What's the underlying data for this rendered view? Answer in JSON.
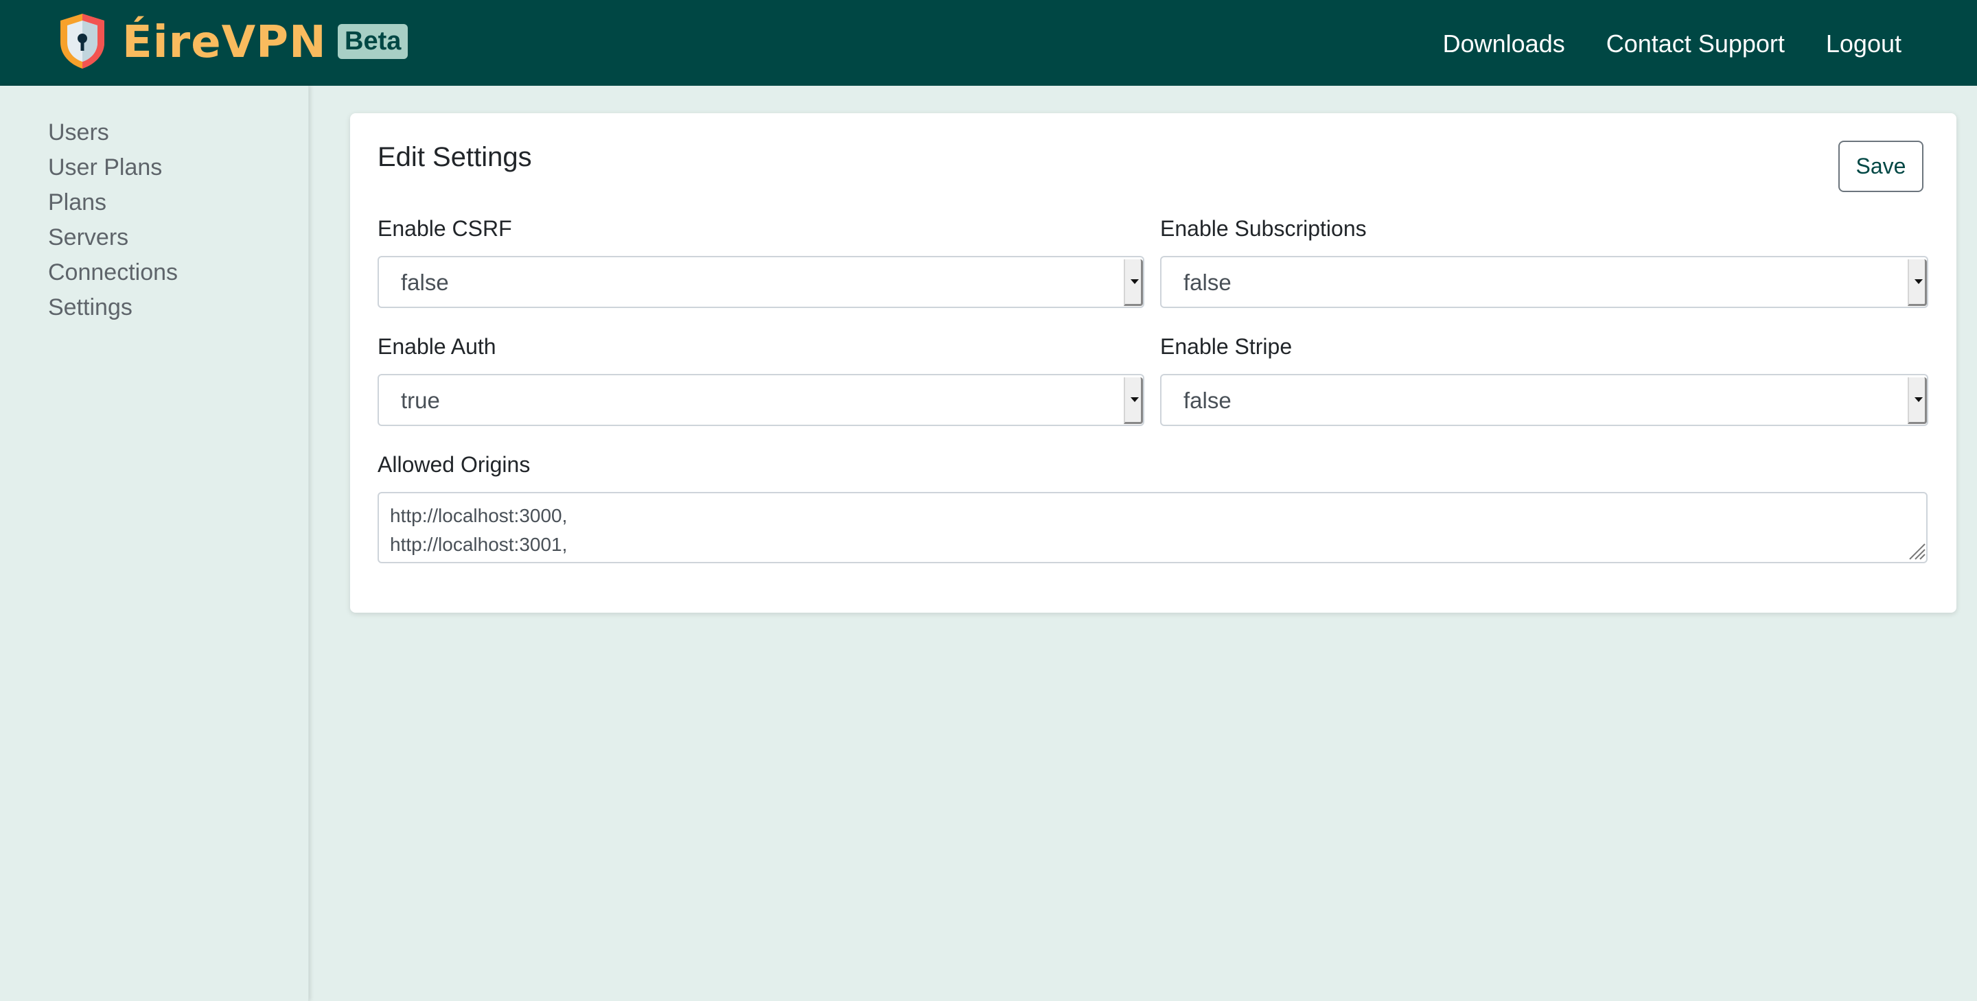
{
  "header": {
    "brand": "ÉireVPN",
    "badge": "Beta",
    "nav": [
      "Downloads",
      "Contact Support",
      "Logout"
    ],
    "colors": {
      "background": "#004744",
      "brand": "#f9bb5e",
      "badge_bg": "#a8cfc5"
    }
  },
  "sidebar": {
    "items": [
      "Users",
      "User Plans",
      "Plans",
      "Servers",
      "Connections",
      "Settings"
    ]
  },
  "card": {
    "title": "Edit Settings",
    "save_label": "Save",
    "fields": {
      "csrf": {
        "label": "Enable CSRF",
        "value": "false"
      },
      "subscriptions": {
        "label": "Enable Subscriptions",
        "value": "false"
      },
      "auth": {
        "label": "Enable Auth",
        "value": "true"
      },
      "stripe": {
        "label": "Enable Stripe",
        "value": "false"
      },
      "origins": {
        "label": "Allowed Origins",
        "value": "http://localhost:3000,\nhttp://localhost:3001,"
      }
    }
  }
}
